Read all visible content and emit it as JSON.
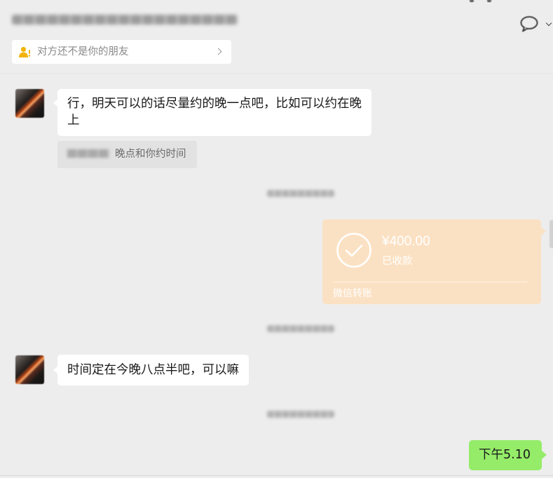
{
  "colors": {
    "background": "#ededed",
    "incoming_bubble": "#ffffff",
    "outgoing_bubble": "#95ec69",
    "transfer_card": "#fbe1c3",
    "notice_icon": "#f2b409"
  },
  "icons": {
    "chat": "chat-bubble-icon",
    "dropdown": "chevron-down-icon",
    "notice": "user-alert-icon",
    "notice_chevron": "chevron-right-icon",
    "transfer": "check-circle-icon"
  },
  "notice": {
    "text": "对方还不是你的朋友"
  },
  "messages": [
    {
      "text": "行，明天可以的话尽量约的晚一点吧，比如可以约在晚上",
      "quote": "晚点和你约时间"
    },
    {
      "amount": "¥400.00",
      "status": "已收款",
      "label": "微信转账"
    },
    {
      "text": "时间定在今晚八点半吧，可以嘛"
    },
    {
      "text": "下午5.10"
    }
  ]
}
